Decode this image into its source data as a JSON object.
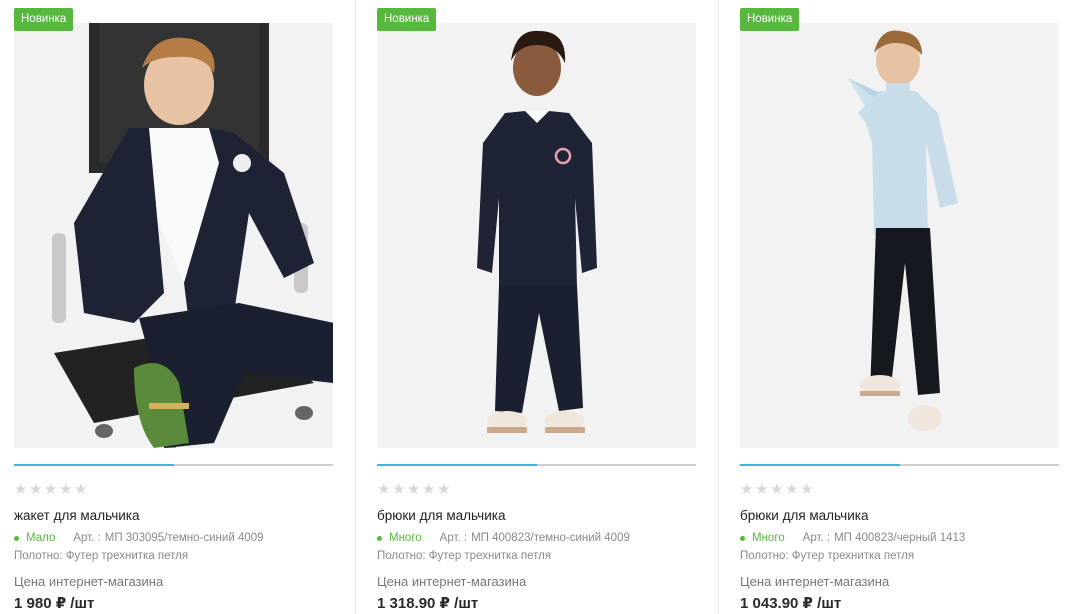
{
  "colors": {
    "badge": "#56b93d",
    "stock": "#56b93d",
    "slider_fill": "#40b4d6",
    "slider_track": "#cfcfcf",
    "star_empty": "#d9d9d9"
  },
  "products": [
    {
      "badge": "Новинка",
      "rating": 0,
      "slider_progress": 0.5,
      "title": "жакет для мальчика",
      "stock": "Мало",
      "art_label": "Арт. :",
      "art_value": "МП 303095/темно-синий 4009",
      "fabric": "Полотно: Футер трехнитка петля",
      "price_label": "Цена интернет-магазина",
      "price": "1 980 ₽ /шт"
    },
    {
      "badge": "Новинка",
      "rating": 0,
      "slider_progress": 0.5,
      "title": "брюки для мальчика",
      "stock": "Много",
      "art_label": "Арт. :",
      "art_value": "МП 400823/темно-синий 4009",
      "fabric": "Полотно: Футер трехнитка петля",
      "price_label": "Цена интернет-магазина",
      "price": "1 318.90 ₽ /шт"
    },
    {
      "badge": "Новинка",
      "rating": 0,
      "slider_progress": 0.5,
      "title": "брюки для мальчика",
      "stock": "Много",
      "art_label": "Арт. :",
      "art_value": "МП 400823/черный 1413",
      "fabric": "Полотно: Футер трехнитка петля",
      "price_label": "Цена интернет-магазина",
      "price": "1 043.90 ₽ /шт"
    }
  ]
}
